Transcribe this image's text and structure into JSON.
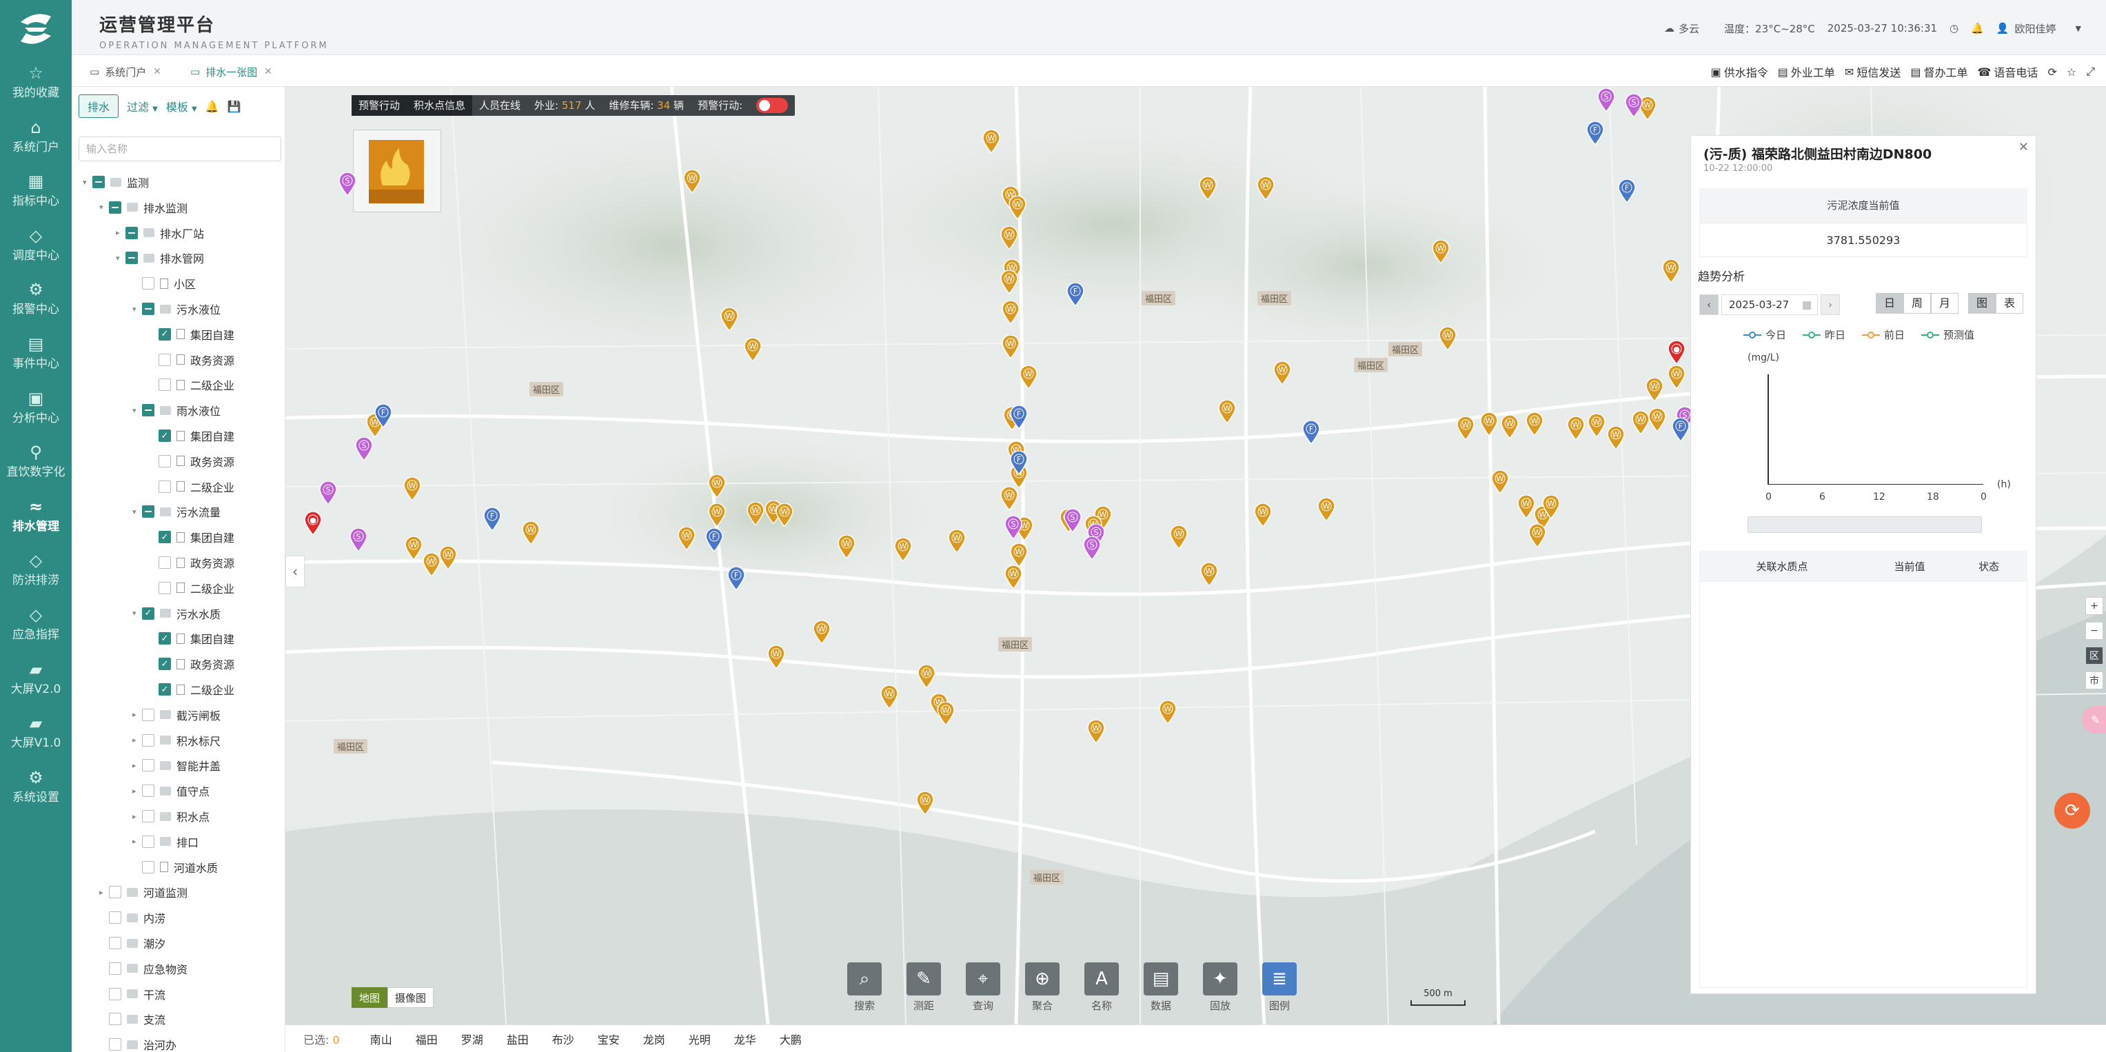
{
  "app": {
    "title": "运营管理平台",
    "subtitle": "OPERATION MANAGEMENT PLATFORM"
  },
  "header": {
    "weather": "多云",
    "temperature": "温度：23°C~28°C",
    "datetime": "2025-03-27 10:36:31",
    "user": "欧阳佳婷"
  },
  "sidebar": {
    "items": [
      {
        "label": "我的收藏",
        "icon": "star-icon"
      },
      {
        "label": "系统门户",
        "icon": "home-icon"
      },
      {
        "label": "指标中心",
        "icon": "chart-icon"
      },
      {
        "label": "调度中心",
        "icon": "cube-icon"
      },
      {
        "label": "报警中心",
        "icon": "alarm-icon"
      },
      {
        "label": "事件中心",
        "icon": "list-icon"
      },
      {
        "label": "分析中心",
        "icon": "analysis-icon"
      },
      {
        "label": "直饮数字化",
        "icon": "tap-icon"
      },
      {
        "label": "排水管理",
        "icon": "drain-icon"
      },
      {
        "label": "防洪排涝",
        "icon": "flood-icon"
      },
      {
        "label": "应急指挥",
        "icon": "emergency-icon"
      },
      {
        "label": "大屏V2.0",
        "icon": "screen-icon"
      },
      {
        "label": "大屏V1.0",
        "icon": "screen-icon"
      },
      {
        "label": "系统设置",
        "icon": "gear-icon"
      }
    ],
    "active_index": 8
  },
  "tabs": [
    {
      "label": "系统门户"
    },
    {
      "label": "排水一张图"
    }
  ],
  "toolbar": {
    "items": [
      "供水指令",
      "外业工单",
      "短信发送",
      "督办工单",
      "语音电话"
    ]
  },
  "leftpanel": {
    "primary_btn": "排水",
    "filter": "过滤",
    "template": "模板",
    "search_placeholder": "输入名称",
    "tree": [
      {
        "label": "监测",
        "level": 0,
        "arrow": "open",
        "check": "partial",
        "type": "folder"
      },
      {
        "label": "排水监测",
        "level": 1,
        "arrow": "open",
        "check": "partial",
        "type": "folder"
      },
      {
        "label": "排水厂站",
        "level": 2,
        "arrow": "closed",
        "check": "partial",
        "type": "folder"
      },
      {
        "label": "排水管网",
        "level": 2,
        "arrow": "open",
        "check": "partial",
        "type": "folder"
      },
      {
        "label": "小区",
        "level": 3,
        "arrow": "",
        "check": "none",
        "type": "file"
      },
      {
        "label": "污水液位",
        "level": 3,
        "arrow": "open",
        "check": "partial",
        "type": "folder"
      },
      {
        "label": "集团自建",
        "level": 4,
        "arrow": "",
        "check": "checked",
        "type": "file"
      },
      {
        "label": "政务资源",
        "level": 4,
        "arrow": "",
        "check": "none",
        "type": "file"
      },
      {
        "label": "二级企业",
        "level": 4,
        "arrow": "",
        "check": "none",
        "type": "file"
      },
      {
        "label": "雨水液位",
        "level": 3,
        "arrow": "open",
        "check": "partial",
        "type": "folder"
      },
      {
        "label": "集团自建",
        "level": 4,
        "arrow": "",
        "check": "checked",
        "type": "file"
      },
      {
        "label": "政务资源",
        "level": 4,
        "arrow": "",
        "check": "none",
        "type": "file"
      },
      {
        "label": "二级企业",
        "level": 4,
        "arrow": "",
        "check": "none",
        "type": "file"
      },
      {
        "label": "污水流量",
        "level": 3,
        "arrow": "open",
        "check": "partial",
        "type": "folder"
      },
      {
        "label": "集团自建",
        "level": 4,
        "arrow": "",
        "check": "checked",
        "type": "file"
      },
      {
        "label": "政务资源",
        "level": 4,
        "arrow": "",
        "check": "none",
        "type": "file"
      },
      {
        "label": "二级企业",
        "level": 4,
        "arrow": "",
        "check": "none",
        "type": "file"
      },
      {
        "label": "污水水质",
        "level": 3,
        "arrow": "open",
        "check": "checked",
        "type": "folder"
      },
      {
        "label": "集团自建",
        "level": 4,
        "arrow": "",
        "check": "checked",
        "type": "file"
      },
      {
        "label": "政务资源",
        "level": 4,
        "arrow": "",
        "check": "checked",
        "type": "file"
      },
      {
        "label": "二级企业",
        "level": 4,
        "arrow": "",
        "check": "checked",
        "type": "file"
      },
      {
        "label": "截污闸板",
        "level": 3,
        "arrow": "closed",
        "check": "none",
        "type": "folder"
      },
      {
        "label": "积水标尺",
        "level": 3,
        "arrow": "closed",
        "check": "none",
        "type": "folder"
      },
      {
        "label": "智能井盖",
        "level": 3,
        "arrow": "closed",
        "check": "none",
        "type": "folder"
      },
      {
        "label": "值守点",
        "level": 3,
        "arrow": "closed",
        "check": "none",
        "type": "folder"
      },
      {
        "label": "积水点",
        "level": 3,
        "arrow": "closed",
        "check": "none",
        "type": "folder"
      },
      {
        "label": "排口",
        "level": 3,
        "arrow": "closed",
        "check": "none",
        "type": "folder"
      },
      {
        "label": "河道水质",
        "level": 3,
        "arrow": "",
        "check": "none",
        "type": "file"
      },
      {
        "label": "河道监测",
        "level": 1,
        "arrow": "closed",
        "check": "none",
        "type": "folder"
      },
      {
        "label": "内涝",
        "level": 1,
        "arrow": "",
        "check": "none",
        "type": "folder"
      },
      {
        "label": "潮汐",
        "level": 1,
        "arrow": "",
        "check": "none",
        "type": "folder"
      },
      {
        "label": "应急物资",
        "level": 1,
        "arrow": "",
        "check": "none",
        "type": "folder"
      },
      {
        "label": "干流",
        "level": 1,
        "arrow": "",
        "check": "none",
        "type": "folder"
      },
      {
        "label": "支流",
        "level": 1,
        "arrow": "",
        "check": "none",
        "type": "folder"
      },
      {
        "label": "治河办",
        "level": 1,
        "arrow": "",
        "check": "none",
        "type": "folder"
      }
    ]
  },
  "map": {
    "bar": {
      "alert_action": "预警行动",
      "ponding_info": "积水点信息",
      "staff_online": "人员在线",
      "field_label": "外业:",
      "field_count": "517",
      "field_unit": "人",
      "repair_label": "维修车辆:",
      "repair_count": "34",
      "repair_unit": "辆",
      "alert_toggle_label": "预警行动:"
    },
    "labels": [
      "福田区",
      "福田区",
      "福田区",
      "福田区",
      "福田区",
      "福田区",
      "福田区",
      "福田区"
    ],
    "bottom_tools": [
      {
        "label": "搜索",
        "icon": "search-icon"
      },
      {
        "label": "测距",
        "icon": "ruler-icon"
      },
      {
        "label": "查询",
        "icon": "location-icon"
      },
      {
        "label": "聚合",
        "icon": "merge-icon"
      },
      {
        "label": "名称",
        "icon": "text-icon"
      },
      {
        "label": "数据",
        "icon": "data-icon"
      },
      {
        "label": "固放",
        "icon": "pin-icon"
      },
      {
        "label": "图例",
        "icon": "legend-icon"
      }
    ],
    "map_type": [
      "地图",
      "摄像图"
    ],
    "scale": "500 m",
    "right_buttons": [
      "+",
      "−",
      "区",
      "市"
    ]
  },
  "detail": {
    "title": "(污-质) 福荣路北侧益田村南边DN800",
    "date": "10-22 12:00:00",
    "value_label": "污泥浓度当前值",
    "value": "3781.550293",
    "trend_title": "趋势分析",
    "date_input": "2025-03-27",
    "period": [
      "日",
      "周",
      "月"
    ],
    "view": [
      "图",
      "表"
    ],
    "legend": [
      {
        "name": "今日",
        "color": "#3a8ad0"
      },
      {
        "name": "昨日",
        "color": "#33b37a"
      },
      {
        "name": "前日",
        "color": "#f0a030"
      },
      {
        "name": "预测值",
        "color": "#33b37a"
      }
    ],
    "unit": "(mg/L)",
    "x_unit": "(h)",
    "x_ticks": [
      "0",
      "6",
      "12",
      "18",
      "0"
    ],
    "table_headers": [
      "关联水质点",
      "当前值",
      "状态"
    ]
  },
  "bottombar": {
    "selected_label": "已选:",
    "selected_count": "0",
    "districts": [
      "南山",
      "福田",
      "罗湖",
      "盐田",
      "布沙",
      "宝安",
      "龙岗",
      "光明",
      "龙华",
      "大鹏"
    ]
  },
  "colors": {
    "primary": "#2e8b84",
    "marker_orange": "#d99a1e",
    "marker_purple": "#c060d8",
    "marker_blue": "#4a78c8",
    "marker_red": "#e02a2a"
  }
}
